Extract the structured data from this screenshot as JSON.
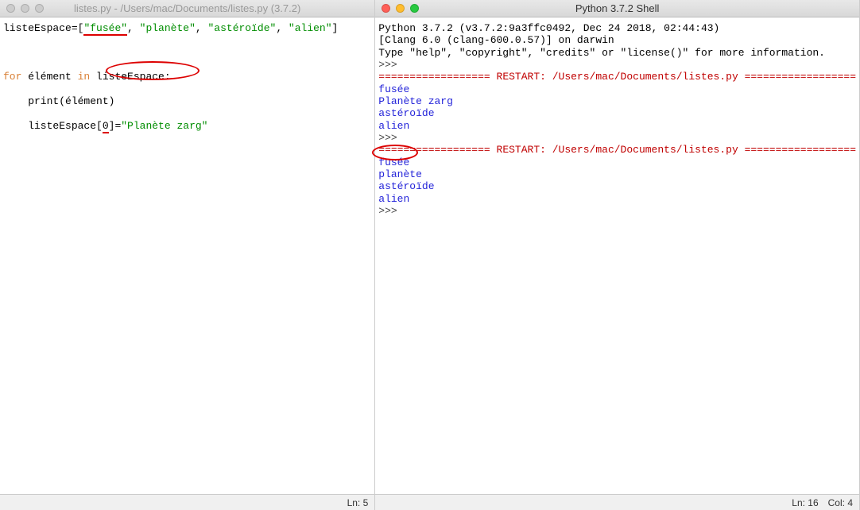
{
  "left": {
    "title": "listes.py - /Users/mac/Documents/listes.py (3.7.2)",
    "code": {
      "l1_var": "listeEspace",
      "l1_eq": "=[",
      "l1_s1": "\"fusée\"",
      "l1_c1": ", ",
      "l1_s2": "\"planète\"",
      "l1_c2": ", ",
      "l1_s3": "\"astéroïde\"",
      "l1_c3": ", ",
      "l1_s4": "\"alien\"",
      "l1_end": "]",
      "l3_for": "for",
      "l3_mid": " élément ",
      "l3_in": "in",
      "l3_rest": " listeEspace:",
      "l4": "    print(élément)",
      "l5_a": "    listeEspace[",
      "l5_idx": "0",
      "l5_b": "]=",
      "l5_str": "\"Planète zarg\""
    },
    "status": {
      "ln": "Ln: 5"
    }
  },
  "right": {
    "title": "Python 3.7.2 Shell",
    "lines": {
      "h1": "Python 3.7.2 (v3.7.2:9a3ffc0492, Dec 24 2018, 02:44:43)",
      "h2": "[Clang 6.0 (clang-600.0.57)] on darwin",
      "h3a": "Type \"help\", \"copyright\", \"credits\" or \"license()\" for more information.",
      "prompt1": ">>> ",
      "restart1a": "================== ",
      "restart1b": "RESTART: /Users/mac/Documents/listes.py",
      "restart1c": " ==================",
      "r1_1": "fusée",
      "r1_2": "Planète zarg",
      "r1_3": "astéroïde",
      "r1_4": "alien",
      "prompt2": ">>> ",
      "restart2a": "================== ",
      "restart2b": "RESTART: /Users/mac/Documents/listes.py",
      "restart2c": " ==================",
      "r2_1": "fusée",
      "r2_2": "planète",
      "r2_3": "astéroïde",
      "r2_4": "alien",
      "prompt3": ">>> "
    },
    "status": {
      "ln": "Ln: 16",
      "col": "Col: 4"
    }
  }
}
